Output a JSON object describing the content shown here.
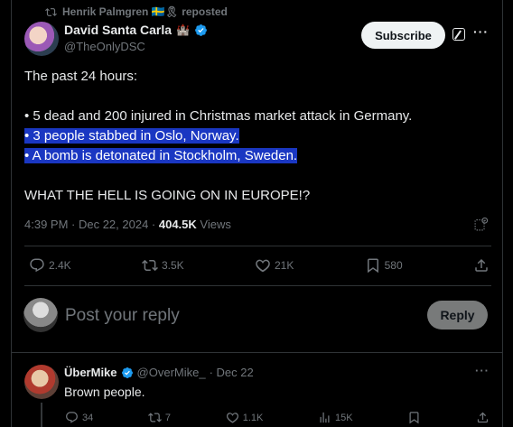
{
  "repost": {
    "text": "Henrik Palmgren 🇸🇪🎗 reposted"
  },
  "author": {
    "name": "David Santa Carla",
    "badge": "🏰",
    "handle": "@TheOnlyDSC"
  },
  "header": {
    "subscribe_label": "Subscribe",
    "more_label": "···"
  },
  "post": {
    "lines": [
      "The past 24 hours:",
      "",
      "• 5 dead and 200 injured in Christmas market attack in Germany.",
      "• 3 people stabbed in Oslo, Norway.",
      "• A bomb is detonated in Stockholm, Sweden.",
      "",
      "WHAT THE HELL IS GOING ON IN EUROPE!?"
    ],
    "time": "4:39 PM · Dec 22, 2024 · ",
    "views_count": "404.5K",
    "views_label": " Views"
  },
  "actions": {
    "replies": "2.4K",
    "reposts": "3.5K",
    "likes": "21K",
    "bookmarks": "580"
  },
  "reply_box": {
    "placeholder": "Post your reply",
    "button_label": "Reply"
  },
  "reply": {
    "name": "ÜberMike",
    "handle": "@OverMike_",
    "date": "· Dec 22",
    "text": "Brown people.",
    "replies": "34",
    "reposts": "7",
    "likes": "1.1K",
    "views": "15K",
    "more_label": "···"
  },
  "colors": {
    "accent": "#1d9bf0",
    "highlight": "#1a37c2",
    "muted": "#71767b"
  }
}
